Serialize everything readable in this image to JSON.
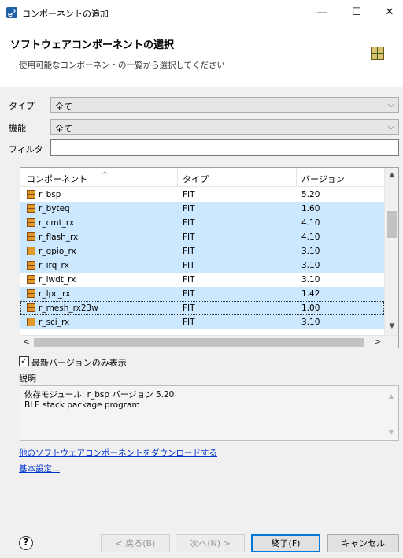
{
  "window": {
    "icon_text": "e",
    "icon_sup": "2",
    "title": "コンポーネントの追加",
    "minimize": "—",
    "maximize": "☐",
    "close": "✕"
  },
  "header": {
    "title": "ソフトウェアコンポーネントの選択",
    "subtitle": "使用可能なコンポーネントの一覧から選択してください"
  },
  "type_label": "タイプ",
  "type_value": "全て",
  "function_label": "機能",
  "function_value": "全て",
  "filter_label": "フィルタ",
  "filter_value": "",
  "table": {
    "headers": [
      "コンポーネント",
      "タイプ",
      "バージョン"
    ],
    "rows": [
      {
        "name": "r_bsp",
        "type": "FIT",
        "version": "5.20",
        "selected": false
      },
      {
        "name": "r_byteq",
        "type": "FIT",
        "version": "1.60",
        "selected": true
      },
      {
        "name": "r_cmt_rx",
        "type": "FIT",
        "version": "4.10",
        "selected": true
      },
      {
        "name": "r_flash_rx",
        "type": "FIT",
        "version": "4.10",
        "selected": true
      },
      {
        "name": "r_gpio_rx",
        "type": "FIT",
        "version": "3.10",
        "selected": true
      },
      {
        "name": "r_irq_rx",
        "type": "FIT",
        "version": "3.10",
        "selected": true
      },
      {
        "name": "r_iwdt_rx",
        "type": "FIT",
        "version": "3.10",
        "selected": false
      },
      {
        "name": "r_lpc_rx",
        "type": "FIT",
        "version": "1.42",
        "selected": true
      },
      {
        "name": "r_mesh_rx23w",
        "type": "FIT",
        "version": "1.00",
        "selected": true,
        "focused": true
      },
      {
        "name": "r_sci_rx",
        "type": "FIT",
        "version": "3.10",
        "selected": true
      }
    ]
  },
  "latest_only": {
    "label": "最新バージョンのみ表示",
    "checked": true,
    "mark": "✓"
  },
  "description": {
    "label": "説明",
    "line1": "依存モジュール: r_bsp バージョン 5.20",
    "line2": "BLE stack package program"
  },
  "links": {
    "download": "他のソフトウェアコンポーネントをダウンロードする",
    "basic_settings": "基本設定..."
  },
  "buttons": {
    "help": "?",
    "back": "< 戻る(B)",
    "next": "次へ(N) >",
    "finish": "終了(F)",
    "cancel": "キャンセル"
  }
}
